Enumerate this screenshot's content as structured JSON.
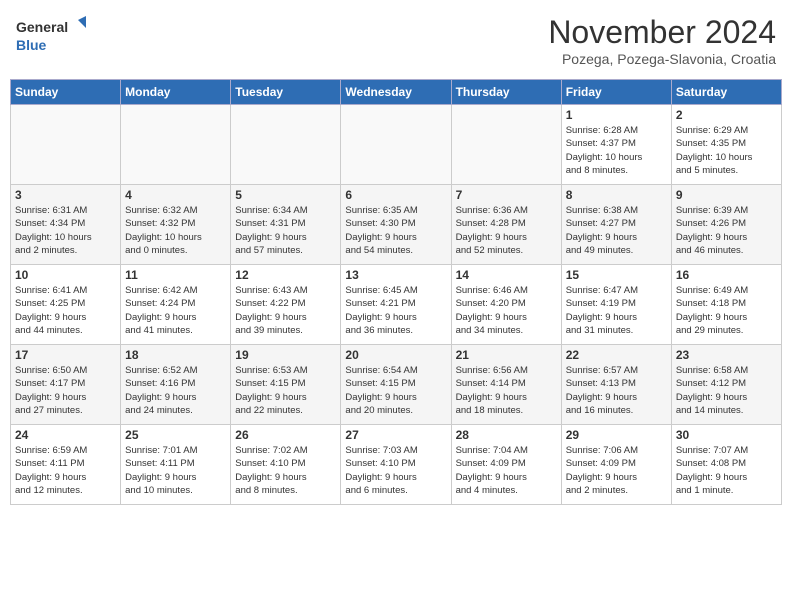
{
  "header": {
    "logo_general": "General",
    "logo_blue": "Blue",
    "month_title": "November 2024",
    "location": "Pozega, Pozega-Slavonia, Croatia"
  },
  "weekdays": [
    "Sunday",
    "Monday",
    "Tuesday",
    "Wednesday",
    "Thursday",
    "Friday",
    "Saturday"
  ],
  "weeks": [
    [
      {
        "day": "",
        "info": ""
      },
      {
        "day": "",
        "info": ""
      },
      {
        "day": "",
        "info": ""
      },
      {
        "day": "",
        "info": ""
      },
      {
        "day": "",
        "info": ""
      },
      {
        "day": "1",
        "info": "Sunrise: 6:28 AM\nSunset: 4:37 PM\nDaylight: 10 hours\nand 8 minutes."
      },
      {
        "day": "2",
        "info": "Sunrise: 6:29 AM\nSunset: 4:35 PM\nDaylight: 10 hours\nand 5 minutes."
      }
    ],
    [
      {
        "day": "3",
        "info": "Sunrise: 6:31 AM\nSunset: 4:34 PM\nDaylight: 10 hours\nand 2 minutes."
      },
      {
        "day": "4",
        "info": "Sunrise: 6:32 AM\nSunset: 4:32 PM\nDaylight: 10 hours\nand 0 minutes."
      },
      {
        "day": "5",
        "info": "Sunrise: 6:34 AM\nSunset: 4:31 PM\nDaylight: 9 hours\nand 57 minutes."
      },
      {
        "day": "6",
        "info": "Sunrise: 6:35 AM\nSunset: 4:30 PM\nDaylight: 9 hours\nand 54 minutes."
      },
      {
        "day": "7",
        "info": "Sunrise: 6:36 AM\nSunset: 4:28 PM\nDaylight: 9 hours\nand 52 minutes."
      },
      {
        "day": "8",
        "info": "Sunrise: 6:38 AM\nSunset: 4:27 PM\nDaylight: 9 hours\nand 49 minutes."
      },
      {
        "day": "9",
        "info": "Sunrise: 6:39 AM\nSunset: 4:26 PM\nDaylight: 9 hours\nand 46 minutes."
      }
    ],
    [
      {
        "day": "10",
        "info": "Sunrise: 6:41 AM\nSunset: 4:25 PM\nDaylight: 9 hours\nand 44 minutes."
      },
      {
        "day": "11",
        "info": "Sunrise: 6:42 AM\nSunset: 4:24 PM\nDaylight: 9 hours\nand 41 minutes."
      },
      {
        "day": "12",
        "info": "Sunrise: 6:43 AM\nSunset: 4:22 PM\nDaylight: 9 hours\nand 39 minutes."
      },
      {
        "day": "13",
        "info": "Sunrise: 6:45 AM\nSunset: 4:21 PM\nDaylight: 9 hours\nand 36 minutes."
      },
      {
        "day": "14",
        "info": "Sunrise: 6:46 AM\nSunset: 4:20 PM\nDaylight: 9 hours\nand 34 minutes."
      },
      {
        "day": "15",
        "info": "Sunrise: 6:47 AM\nSunset: 4:19 PM\nDaylight: 9 hours\nand 31 minutes."
      },
      {
        "day": "16",
        "info": "Sunrise: 6:49 AM\nSunset: 4:18 PM\nDaylight: 9 hours\nand 29 minutes."
      }
    ],
    [
      {
        "day": "17",
        "info": "Sunrise: 6:50 AM\nSunset: 4:17 PM\nDaylight: 9 hours\nand 27 minutes."
      },
      {
        "day": "18",
        "info": "Sunrise: 6:52 AM\nSunset: 4:16 PM\nDaylight: 9 hours\nand 24 minutes."
      },
      {
        "day": "19",
        "info": "Sunrise: 6:53 AM\nSunset: 4:15 PM\nDaylight: 9 hours\nand 22 minutes."
      },
      {
        "day": "20",
        "info": "Sunrise: 6:54 AM\nSunset: 4:15 PM\nDaylight: 9 hours\nand 20 minutes."
      },
      {
        "day": "21",
        "info": "Sunrise: 6:56 AM\nSunset: 4:14 PM\nDaylight: 9 hours\nand 18 minutes."
      },
      {
        "day": "22",
        "info": "Sunrise: 6:57 AM\nSunset: 4:13 PM\nDaylight: 9 hours\nand 16 minutes."
      },
      {
        "day": "23",
        "info": "Sunrise: 6:58 AM\nSunset: 4:12 PM\nDaylight: 9 hours\nand 14 minutes."
      }
    ],
    [
      {
        "day": "24",
        "info": "Sunrise: 6:59 AM\nSunset: 4:11 PM\nDaylight: 9 hours\nand 12 minutes."
      },
      {
        "day": "25",
        "info": "Sunrise: 7:01 AM\nSunset: 4:11 PM\nDaylight: 9 hours\nand 10 minutes."
      },
      {
        "day": "26",
        "info": "Sunrise: 7:02 AM\nSunset: 4:10 PM\nDaylight: 9 hours\nand 8 minutes."
      },
      {
        "day": "27",
        "info": "Sunrise: 7:03 AM\nSunset: 4:10 PM\nDaylight: 9 hours\nand 6 minutes."
      },
      {
        "day": "28",
        "info": "Sunrise: 7:04 AM\nSunset: 4:09 PM\nDaylight: 9 hours\nand 4 minutes."
      },
      {
        "day": "29",
        "info": "Sunrise: 7:06 AM\nSunset: 4:09 PM\nDaylight: 9 hours\nand 2 minutes."
      },
      {
        "day": "30",
        "info": "Sunrise: 7:07 AM\nSunset: 4:08 PM\nDaylight: 9 hours\nand 1 minute."
      }
    ]
  ]
}
